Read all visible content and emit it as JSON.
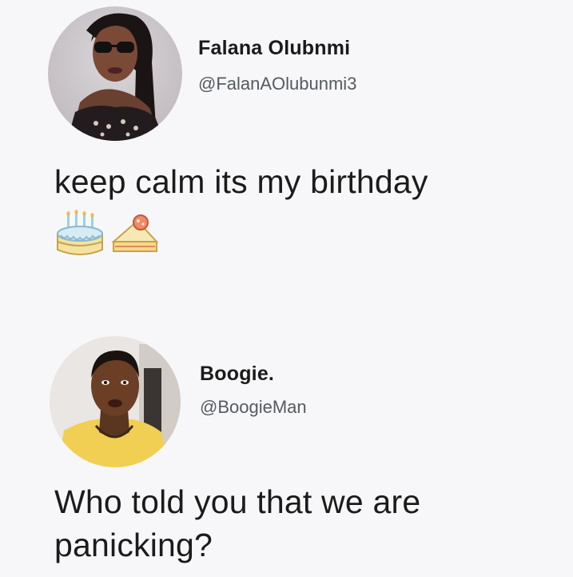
{
  "tweets": [
    {
      "display_name": "Falana Olubnmi",
      "handle": "@FalanAOlubunmi3",
      "text": "keep calm its my birthday",
      "emojis": [
        "birthday-cake-icon",
        "cake-slice-icon"
      ]
    },
    {
      "display_name": "Boogie.",
      "handle": "@BoogieMan",
      "text": "Who told you that we are panicking?"
    }
  ],
  "colors": {
    "background": "#f7f7f9",
    "text": "#1b1b1b",
    "handle": "#555a60"
  }
}
